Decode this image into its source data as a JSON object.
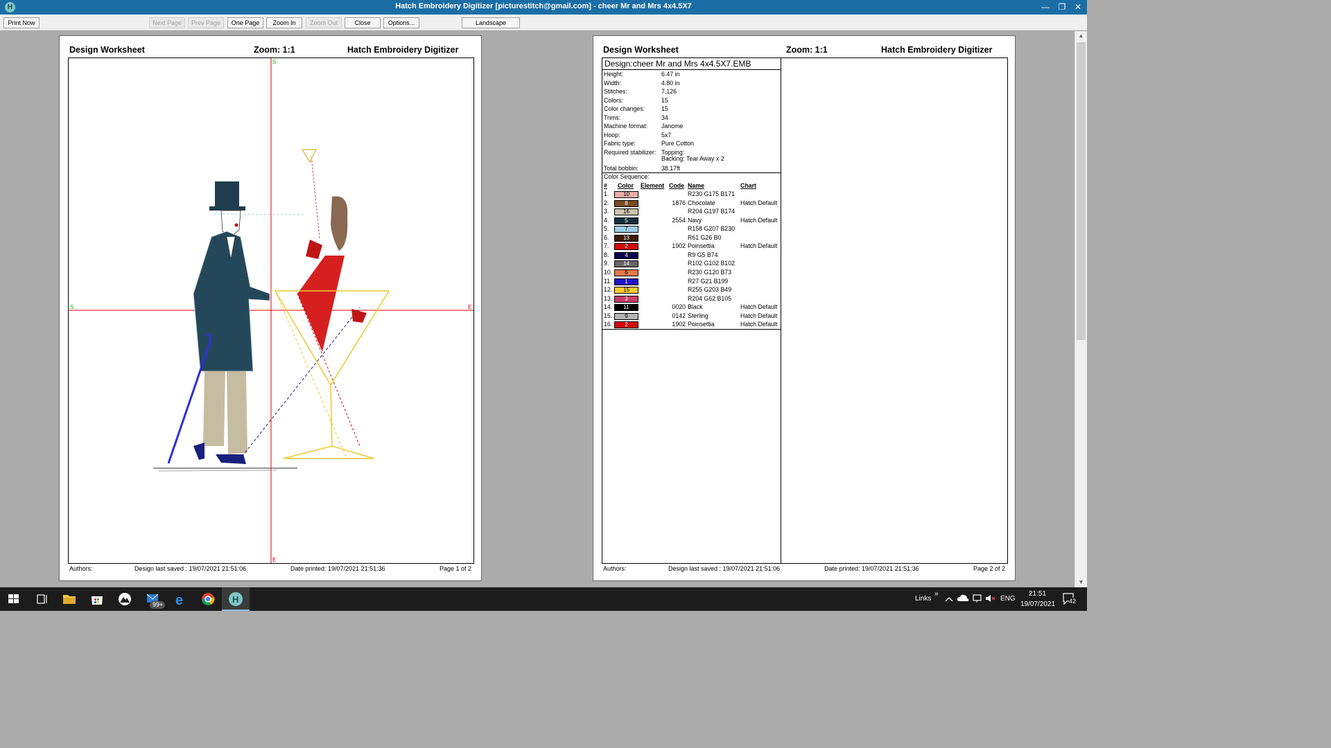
{
  "window": {
    "title": "Hatch Embroidery Digitizer [picturestitch@gmail.com] - cheer Mr and Mrs 4x4.5X7",
    "app_icon": "H",
    "minimize": "—",
    "restore": "❐",
    "close": "✕"
  },
  "toolbar": {
    "print_now": "Print Now",
    "next_page": "Next Page",
    "prev_page": "Prev Page",
    "one_page": "One Page",
    "zoom_in": "Zoom In",
    "zoom_out": "Zoom Out",
    "close": "Close",
    "options": "Options...",
    "landscape": "Landscape"
  },
  "page1": {
    "heading": "Design Worksheet",
    "zoom": "Zoom:  1:1",
    "app_name": "Hatch Embroidery Digitizer",
    "marker_s_top": "S",
    "marker_e_bottom": "E",
    "marker_s_left": "S",
    "marker_e_right": "E",
    "authors": "Authors:",
    "last_saved": "Design last saved : 19/07/2021 21:51:06",
    "date_printed": "Date printed: 19/07/2021 21:51:36",
    "page_no": "Page 1 of 2"
  },
  "page2": {
    "heading": "Design Worksheet",
    "zoom": "Zoom:  1:1",
    "app_name": "Hatch Embroidery Digitizer",
    "design_name": "Design:cheer Mr and Mrs 4x4.5X7.EMB",
    "props": {
      "height_label": "Height:",
      "height": "6.47 in",
      "width_label": "Width:",
      "width": "4.80 in",
      "stitches_label": "Stitches:",
      "stitches": "7,126",
      "colors_label": "Colors:",
      "colors": "15",
      "color_changes_label": "Color changes:",
      "color_changes": "15",
      "trims_label": "Trims:",
      "trims": "34",
      "machine_format_label": "Machine format:",
      "machine_format": "Janome",
      "hoop_label": "Hoop:",
      "hoop": "5x7",
      "fabric_type_label": "Fabric type:",
      "fabric_type": "Pure Cotton",
      "stabilizer_label": "Required stabilizer:",
      "stabilizer_topping": "Topping:",
      "stabilizer_backing": "Backing: Tear Away x 2",
      "bobbin_label": "Total bobbin:",
      "bobbin": "38.17ft"
    },
    "sequence": {
      "title": "Color Sequence:",
      "headers": {
        "num": "#",
        "color": "Color",
        "element": "Element",
        "code": "Code",
        "name": "Name",
        "chart": "Chart"
      },
      "rows": [
        {
          "n": "1.",
          "swatch": "10",
          "color": "#e6afab",
          "text_color": "#000",
          "code": "",
          "name": "R230 G175 B171",
          "chart": ""
        },
        {
          "n": "2.",
          "swatch": "8",
          "color": "#7b4a25",
          "text_color": "#fff",
          "code": "1876",
          "name": "Chocolate",
          "chart": "Hatch Default"
        },
        {
          "n": "3.",
          "swatch": "16",
          "color": "#ccc5ae",
          "text_color": "#000",
          "code": "",
          "name": "R204 G197 B174",
          "chart": ""
        },
        {
          "n": "4.",
          "swatch": "5",
          "color": "#0f2f3c",
          "text_color": "#fff",
          "code": "2554",
          "name": "Navy",
          "chart": "Hatch Default"
        },
        {
          "n": "5.",
          "swatch": "7",
          "color": "#9ecfe6",
          "text_color": "#000",
          "code": "",
          "name": "R158 G207 B230",
          "chart": ""
        },
        {
          "n": "6.",
          "swatch": "13",
          "color": "#3d1a00",
          "text_color": "#fff",
          "code": "",
          "name": "R61 G26 B0",
          "chart": ""
        },
        {
          "n": "7.",
          "swatch": "2",
          "color": "#d10a0a",
          "text_color": "#fff",
          "code": "1902",
          "name": "Poinsettia",
          "chart": "Hatch Default"
        },
        {
          "n": "8.",
          "swatch": "4",
          "color": "#09054a",
          "text_color": "#fff",
          "code": "",
          "name": "R9 G5 B74",
          "chart": ""
        },
        {
          "n": "9.",
          "swatch": "14",
          "color": "#666666",
          "text_color": "#fff",
          "code": "",
          "name": "R102 G102 B102",
          "chart": ""
        },
        {
          "n": "10.",
          "swatch": "6",
          "color": "#e67849",
          "text_color": "#000",
          "code": "",
          "name": "R230 G120 B73",
          "chart": ""
        },
        {
          "n": "11.",
          "swatch": "1",
          "color": "#1b15c7",
          "text_color": "#fff",
          "code": "",
          "name": "R27 G21 B199",
          "chart": ""
        },
        {
          "n": "12.",
          "swatch": "15",
          "color": "#ffcb31",
          "text_color": "#000",
          "code": "",
          "name": "R255 G203 B49",
          "chart": ""
        },
        {
          "n": "13.",
          "swatch": "3",
          "color": "#cc3e69",
          "text_color": "#fff",
          "code": "",
          "name": "R204 G62 B105",
          "chart": ""
        },
        {
          "n": "14.",
          "swatch": "11",
          "color": "#000000",
          "text_color": "#fff",
          "code": "0020",
          "name": "Black",
          "chart": "Hatch Default"
        },
        {
          "n": "15.",
          "swatch": "9",
          "color": "#b4b4b4",
          "text_color": "#000",
          "code": "0142",
          "name": "Sterling",
          "chart": "Hatch Default"
        },
        {
          "n": "16.",
          "swatch": "2",
          "color": "#d10a0a",
          "text_color": "#fff",
          "code": "1902",
          "name": "Poinsettia",
          "chart": "Hatch Default"
        }
      ]
    },
    "authors": "Authors:",
    "last_saved": "Design last saved : 19/07/2021 21:51:06",
    "date_printed": "Date printed: 19/07/2021 21:51:36",
    "page_no": "Page 2 of 2"
  },
  "taskbar": {
    "mail_badge": "99+",
    "links": "Links",
    "chevron": "»",
    "language": "ENG",
    "time": "21:51",
    "date": "19/07/2021",
    "notification_count": "42"
  }
}
